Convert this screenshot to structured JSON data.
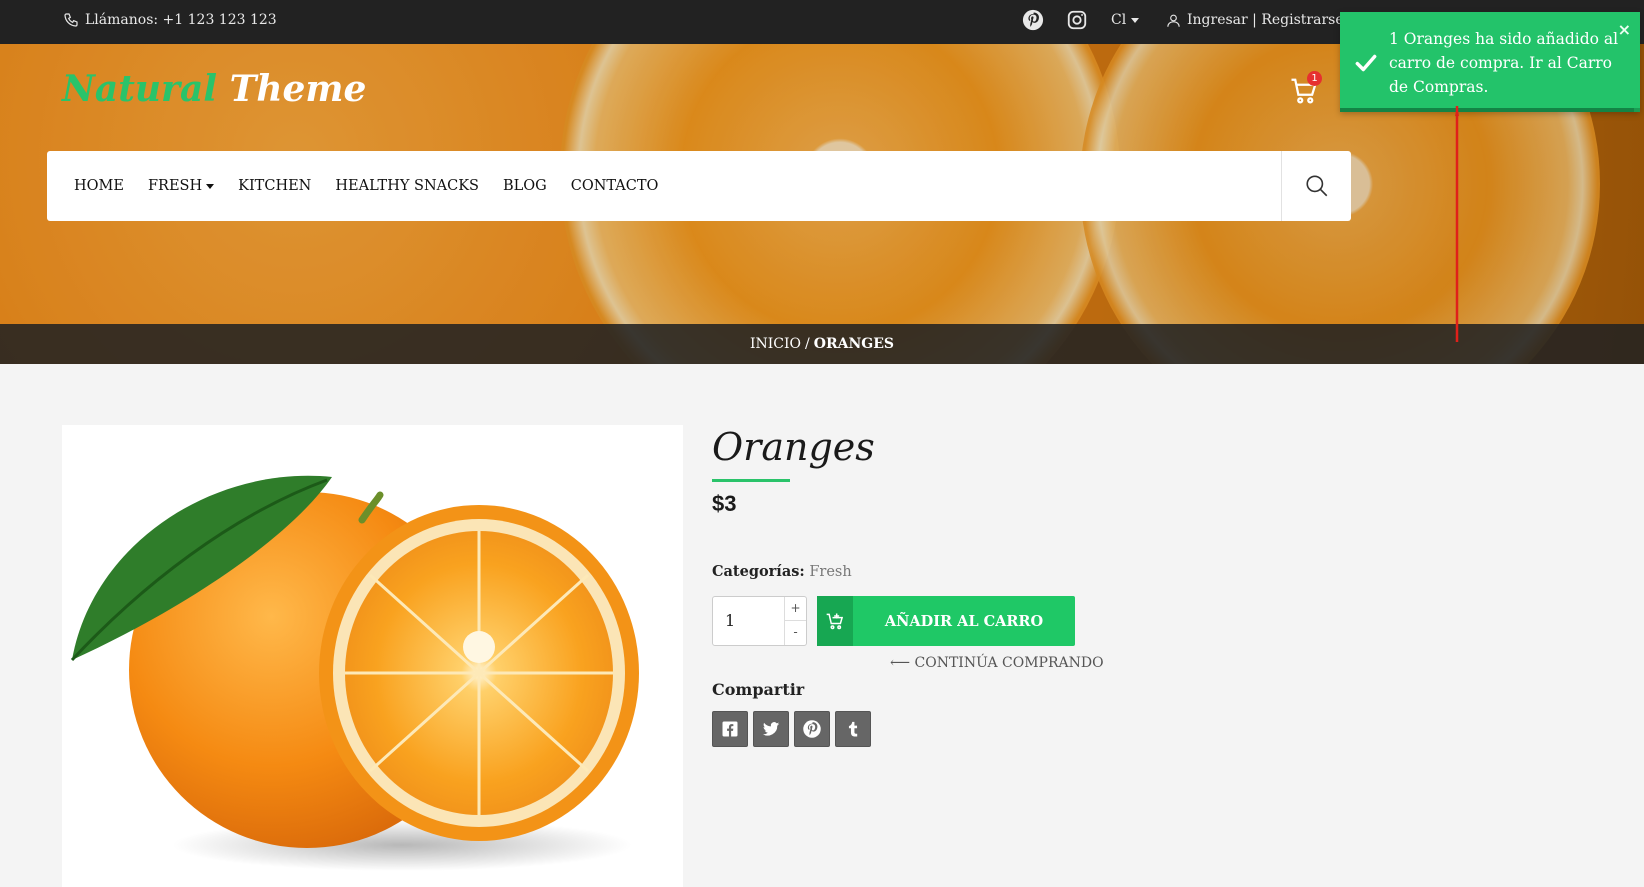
{
  "topbar": {
    "phone": "Llámanos: +1 123 123 123",
    "currency": "Cl",
    "account": "Ingresar | Registrarse"
  },
  "brand": {
    "part1": "Natural",
    "part2": "Theme"
  },
  "cart": {
    "count": "1"
  },
  "nav": {
    "items": [
      {
        "label": "HOME"
      },
      {
        "label": "FRESH",
        "has_dropdown": true
      },
      {
        "label": "KITCHEN"
      },
      {
        "label": "HEALTHY SNACKS"
      },
      {
        "label": "BLOG"
      },
      {
        "label": "CONTACTO"
      }
    ]
  },
  "breadcrumb": {
    "home": "INICIO",
    "separator": "/",
    "current": "ORANGES"
  },
  "toast": {
    "message": "1 Oranges ha sido añadido al carro de compra. Ir al Carro de Compras.",
    "close": "×",
    "progress": 0.98,
    "color": "#23c36a"
  },
  "product": {
    "title": "Oranges",
    "price": "$3",
    "categories_label": "Categorías:",
    "categories_value": "Fresh",
    "quantity": "1",
    "plus": "+",
    "minus": "-",
    "add_to_cart": "AÑADIR AL CARRO",
    "continue": "⟵ CONTINÚA COMPRANDO",
    "share_title": "Compartir"
  },
  "colors": {
    "accent": "#1fc866",
    "topbar": "#222222",
    "badge": "#e63030"
  },
  "icons": [
    "phone-icon",
    "pinterest-icon",
    "instagram-icon",
    "user-icon",
    "cart-icon",
    "search-icon",
    "check-icon",
    "add-cart-icon",
    "facebook-icon",
    "twitter-icon",
    "pinterest-share-icon",
    "tumblr-icon"
  ]
}
